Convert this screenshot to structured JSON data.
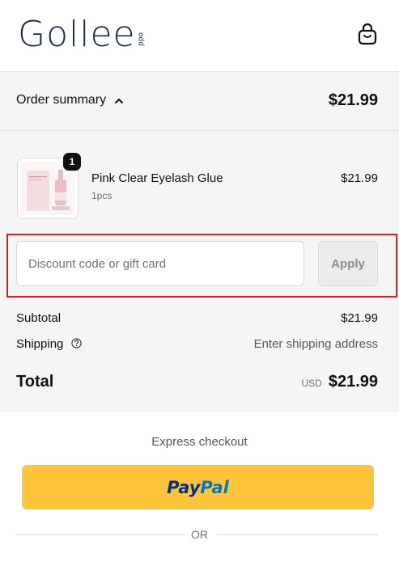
{
  "brand": {
    "logo_text": "Gollee",
    "logo_subtext": "odd"
  },
  "header": {
    "cart_icon": "shopping-bag-icon"
  },
  "order_summary": {
    "toggle_label": "Order summary",
    "toggle_icon": "chevron-up-icon",
    "total": "$21.99"
  },
  "line_items": [
    {
      "name": "Pink Clear Eyelash Glue",
      "variant": "1pcs",
      "price": "$21.99",
      "quantity": "1"
    }
  ],
  "discount": {
    "placeholder": "Discount code or gift card",
    "value": "",
    "apply_label": "Apply"
  },
  "totals": {
    "subtotal_label": "Subtotal",
    "subtotal_value": "$21.99",
    "shipping_label": "Shipping",
    "shipping_value": "Enter shipping address",
    "total_label": "Total",
    "currency": "USD",
    "total_value": "$21.99"
  },
  "express": {
    "label": "Express checkout",
    "paypal_part1": "Pay",
    "paypal_part2": "Pal",
    "or_label": "OR"
  },
  "colors": {
    "highlight": "#e01b24",
    "paypal": "#ffc439",
    "brand": "#1d2a4d"
  }
}
